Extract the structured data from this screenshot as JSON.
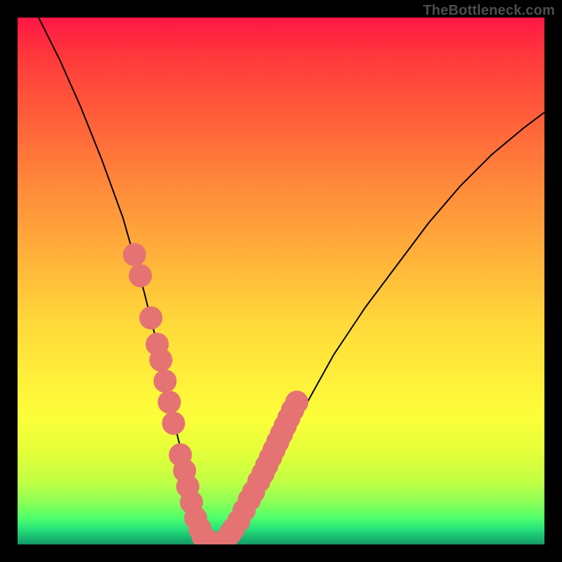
{
  "watermark": "TheBottleneck.com",
  "chart_data": {
    "type": "line",
    "title": "",
    "xlabel": "",
    "ylabel": "",
    "xlim": [
      0,
      100
    ],
    "ylim": [
      0,
      100
    ],
    "series": [
      {
        "name": "left-curve",
        "x": [
          4,
          8,
          12,
          16,
          20,
          22,
          24,
          26,
          28,
          30,
          32,
          33.5,
          35,
          36.5
        ],
        "y": [
          100,
          92,
          83,
          73,
          62,
          55,
          48,
          40,
          31,
          22,
          14,
          8,
          3,
          0
        ]
      },
      {
        "name": "right-curve",
        "x": [
          38,
          40,
          43,
          46,
          50,
          55,
          60,
          66,
          72,
          78,
          84,
          90,
          96,
          100
        ],
        "y": [
          0,
          2,
          6,
          11,
          18,
          27,
          36,
          45,
          53,
          61,
          68,
          74,
          79,
          82
        ]
      }
    ],
    "markers": {
      "name": "data-beads",
      "color": "#e57373",
      "radius": 2.2,
      "points": [
        {
          "x": 22.2,
          "y": 55
        },
        {
          "x": 23.3,
          "y": 51
        },
        {
          "x": 25.3,
          "y": 43
        },
        {
          "x": 26.5,
          "y": 38
        },
        {
          "x": 27.2,
          "y": 35
        },
        {
          "x": 28.0,
          "y": 31
        },
        {
          "x": 28.8,
          "y": 27
        },
        {
          "x": 29.6,
          "y": 23
        },
        {
          "x": 30.9,
          "y": 17
        },
        {
          "x": 31.7,
          "y": 14
        },
        {
          "x": 32.3,
          "y": 11
        },
        {
          "x": 33.0,
          "y": 8
        },
        {
          "x": 33.8,
          "y": 5
        },
        {
          "x": 34.6,
          "y": 3
        },
        {
          "x": 35.2,
          "y": 1.5
        },
        {
          "x": 36.0,
          "y": 0.8
        },
        {
          "x": 36.8,
          "y": 0.3
        },
        {
          "x": 37.7,
          "y": 0.1
        },
        {
          "x": 38.6,
          "y": 0.2
        },
        {
          "x": 39.5,
          "y": 0.8
        },
        {
          "x": 40.3,
          "y": 2
        },
        {
          "x": 41.0,
          "y": 3
        },
        {
          "x": 42.0,
          "y": 4.5
        },
        {
          "x": 43.0,
          "y": 6.5
        },
        {
          "x": 44.0,
          "y": 8.5
        },
        {
          "x": 44.8,
          "y": 10
        },
        {
          "x": 45.8,
          "y": 12
        },
        {
          "x": 46.6,
          "y": 13.5
        },
        {
          "x": 47.3,
          "y": 15
        },
        {
          "x": 48.0,
          "y": 16.5
        },
        {
          "x": 48.7,
          "y": 18
        },
        {
          "x": 49.4,
          "y": 19.5
        },
        {
          "x": 50.1,
          "y": 21
        },
        {
          "x": 50.8,
          "y": 22.5
        },
        {
          "x": 51.5,
          "y": 24
        },
        {
          "x": 52.2,
          "y": 25.5
        },
        {
          "x": 53.0,
          "y": 27
        }
      ]
    }
  }
}
